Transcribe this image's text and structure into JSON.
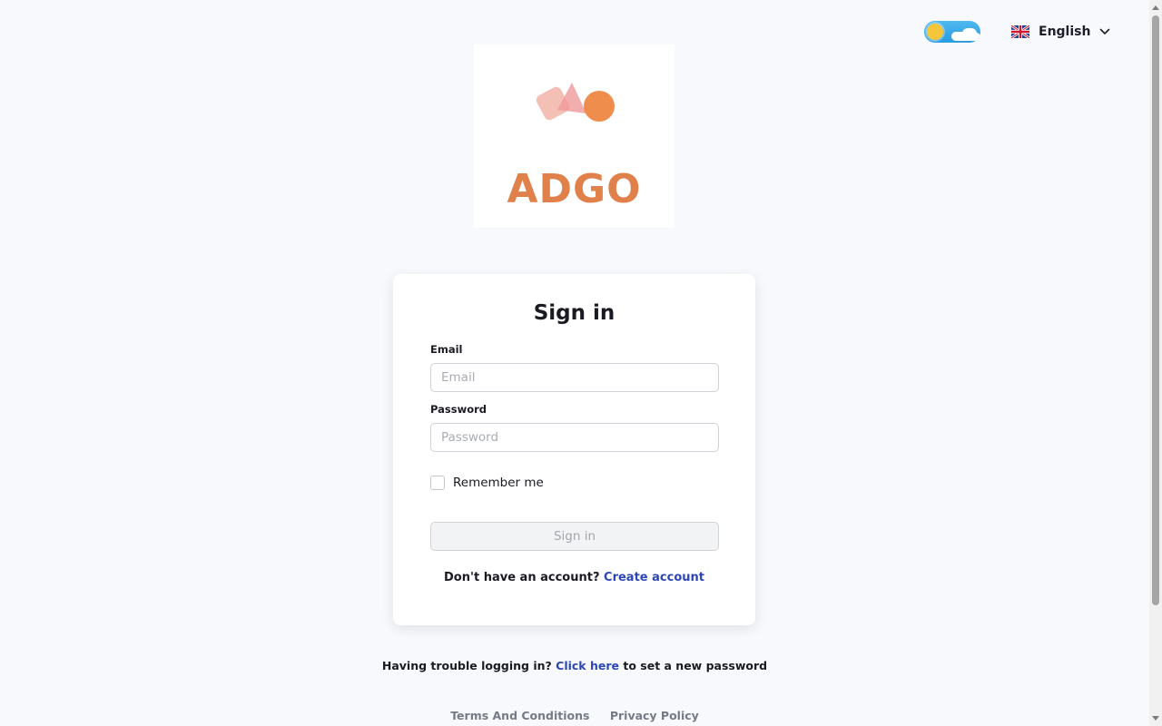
{
  "header": {
    "theme_toggle_icon": "sun-cloud-icon",
    "language_label": "English",
    "language_flag_icon": "uk-flag-icon"
  },
  "logo": {
    "text": "ADGO",
    "color": "#e0804a"
  },
  "signin": {
    "title": "Sign in",
    "email_label": "Email",
    "email_placeholder": "Email",
    "email_value": "",
    "password_label": "Password",
    "password_placeholder": "Password",
    "password_value": "",
    "remember_label": "Remember me",
    "submit_label": "Sign in",
    "no_account_text": "Don't have an account?",
    "create_account_link": "Create account"
  },
  "trouble": {
    "prefix": "Having trouble logging in?",
    "link": "Click here",
    "suffix": "to set a new password"
  },
  "footer": {
    "terms": "Terms And Conditions",
    "privacy": "Privacy Policy"
  },
  "colors": {
    "link": "#2c47b5",
    "background": "#f8f9fc"
  }
}
